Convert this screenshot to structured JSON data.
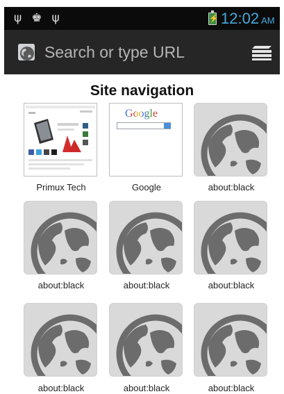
{
  "status_bar": {
    "icons": [
      "usb-icon",
      "android-debug-icon",
      "usb-icon"
    ],
    "time": "12:02",
    "ampm": "AM",
    "battery_color": "#3d8d47",
    "clock_color": "#47a9de"
  },
  "url_bar": {
    "placeholder": "Search or type URL",
    "favicon": "globe-favicon-icon",
    "menu_icon": "tabs-stack-icon"
  },
  "page": {
    "title": "Site navigation"
  },
  "tiles": [
    {
      "label": "Primux Tech",
      "thumbnail": "site-screenshot"
    },
    {
      "label": "Google",
      "thumbnail": "google-screenshot"
    },
    {
      "label": "about:black",
      "thumbnail": "globe-icon"
    },
    {
      "label": "about:black",
      "thumbnail": "globe-icon"
    },
    {
      "label": "about:black",
      "thumbnail": "globe-icon"
    },
    {
      "label": "about:black",
      "thumbnail": "globe-icon"
    },
    {
      "label": "about:black",
      "thumbnail": "globe-icon"
    },
    {
      "label": "about:black",
      "thumbnail": "globe-icon"
    },
    {
      "label": "about:black",
      "thumbnail": "globe-icon"
    }
  ],
  "google_logo_text": "Google"
}
